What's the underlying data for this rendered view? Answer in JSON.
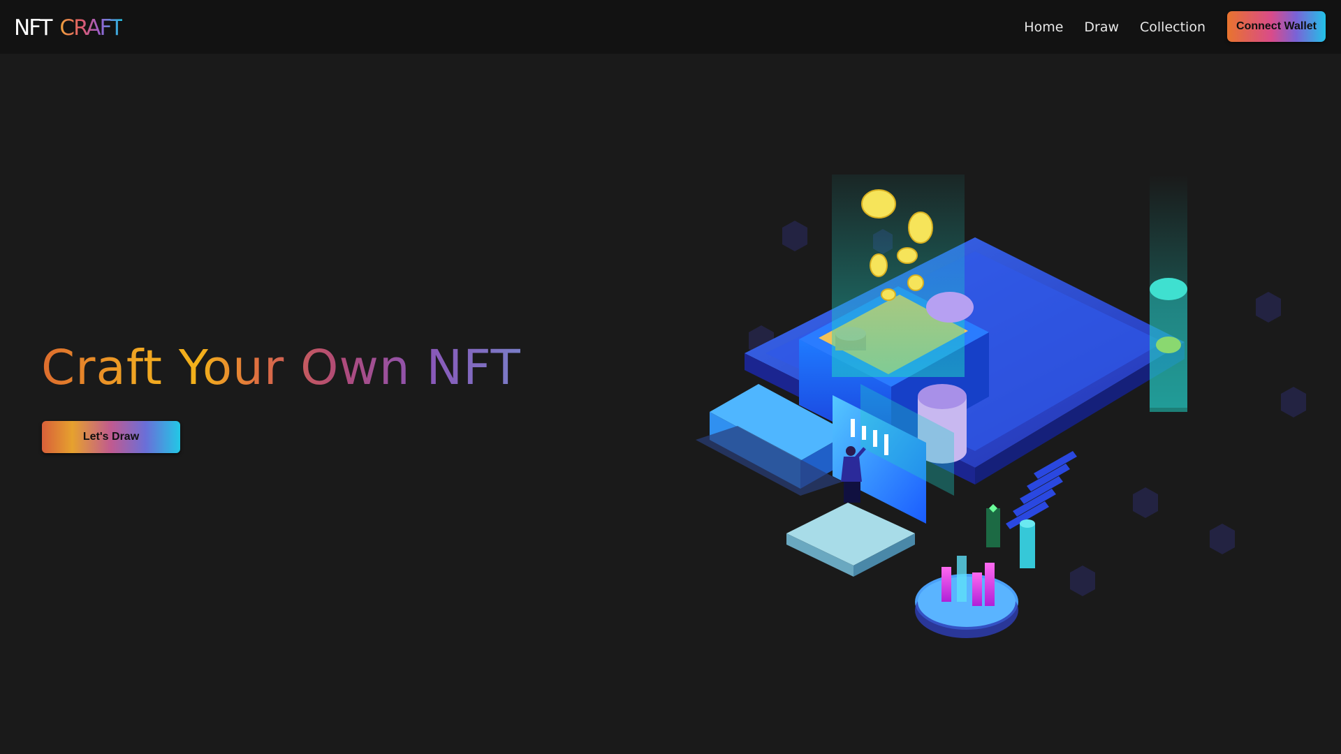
{
  "nav": {
    "logo_part1": "NFT",
    "logo_part2": "CRAFT",
    "links": [
      {
        "label": "Home"
      },
      {
        "label": "Draw"
      },
      {
        "label": "Collection"
      }
    ],
    "connect_wallet_label": "Connect Wallet"
  },
  "hero": {
    "title": "Craft Your Own NFT",
    "cta_label": "Let's Draw"
  },
  "illustration": {
    "icon": "isometric-crypto-illustration"
  },
  "colors": {
    "background": "#1a1a1a",
    "navbar": "#121212",
    "gradient_orange": "#dd6c2e",
    "gradient_yellow": "#f2b11a",
    "gradient_purple": "#8a56b8",
    "gradient_cyan": "#22c8e6"
  }
}
